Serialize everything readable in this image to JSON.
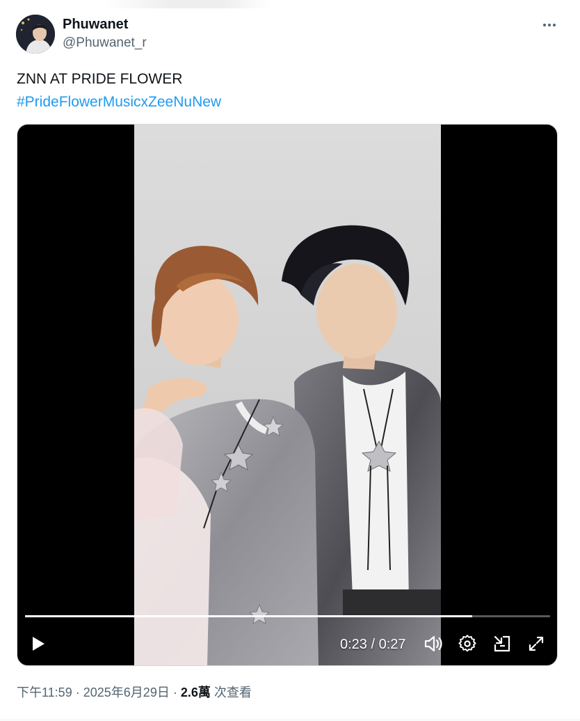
{
  "author": {
    "display_name": "Phuwanet",
    "handle": "@Phuwanet_r"
  },
  "more_icon": "more-horizontal-icon",
  "post": {
    "text": "ZNN AT PRIDE FLOWER",
    "hashtag": "#PrideFlowerMusicxZeeNuNew"
  },
  "video": {
    "time_display": "0:23 / 0:27",
    "progress": 0.852,
    "controls": [
      "play-icon",
      "volume-icon",
      "settings-icon",
      "pip-icon",
      "fullscreen-icon"
    ]
  },
  "meta": {
    "time": "下午11:59",
    "date": "2025年6月29日",
    "separator": "·",
    "views_count": "2.6萬",
    "views_label": "次查看"
  },
  "colors": {
    "link": "#1d9bf0",
    "secondary_text": "#536471",
    "primary_text": "#0f1419"
  }
}
